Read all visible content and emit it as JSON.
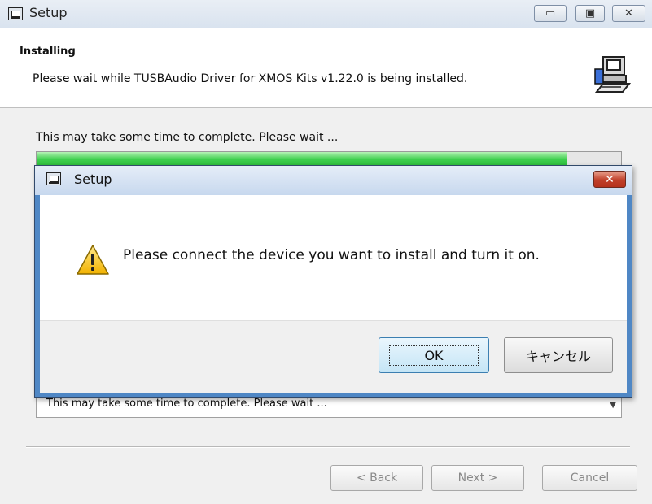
{
  "window": {
    "title": "Setup",
    "controls": {
      "minimize": "▭",
      "maximize": "▣",
      "close": "✕"
    }
  },
  "header": {
    "title": "Installing",
    "subtitle": "Please wait while TUSBAudio Driver for XMOS Kits v1.22.0 is being installed.",
    "icon": "installer-computer-icon"
  },
  "content": {
    "status_text": "This may take some time to complete. Please wait ...",
    "progress_fraction": 0.906,
    "progress_color": "#3fd04f",
    "log_line": "This may take some time to complete. Please wait ...",
    "log_arrow": "▼"
  },
  "footer": {
    "back_label": "< Back",
    "next_label": "Next >",
    "cancel_label": "Cancel"
  },
  "dialog": {
    "title": "Setup",
    "close_glyph": "✕",
    "message": "Please connect the device you want to install and turn it on.",
    "icon": "warning-icon",
    "ok_label": "OK",
    "cancel_label": "キャンセル",
    "close_color": "#c0402a"
  }
}
